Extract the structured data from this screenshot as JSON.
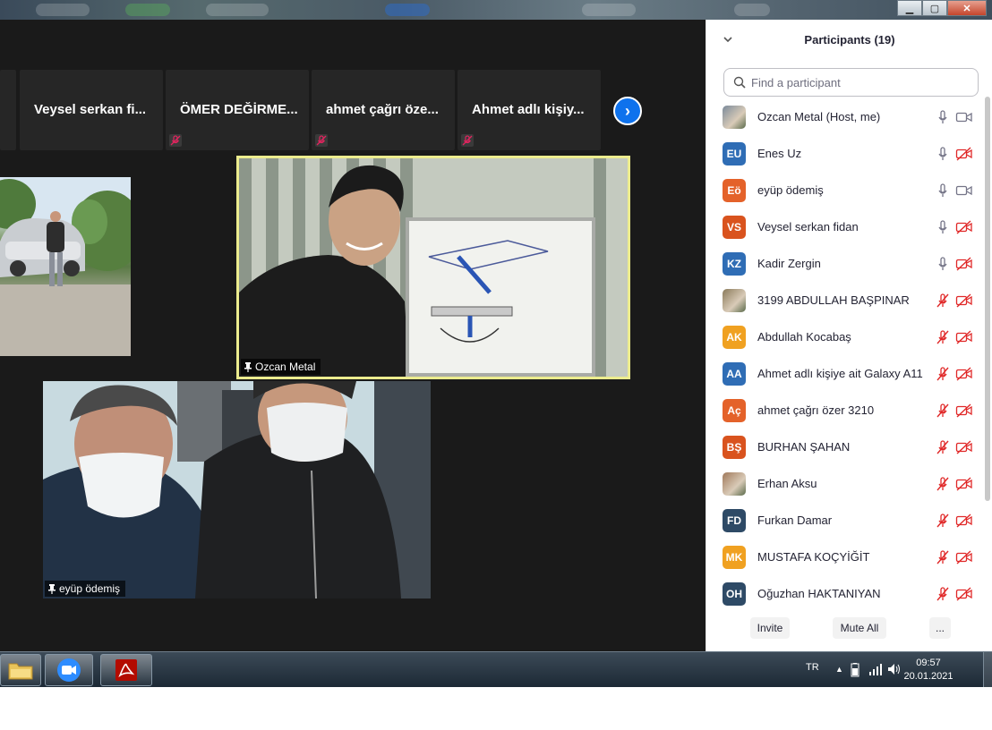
{
  "window": {
    "minimize_icon": "minimize-icon",
    "maximize_icon": "restore-icon",
    "close_icon": "close-icon"
  },
  "video_strip": {
    "tiles": [
      {
        "name": "Veysel serkan fi...",
        "muted": false
      },
      {
        "name": "ÖMER DEĞİRME...",
        "muted": true
      },
      {
        "name": "ahmet çağrı öze...",
        "muted": true
      },
      {
        "name": "Ahmet adlı kişiy...",
        "muted": true
      }
    ],
    "next_icon": "chevron-right-icon"
  },
  "videos": {
    "main_label": "Ozcan Metal",
    "masks_label": "eyüp ödemiş"
  },
  "participants": {
    "title": "Participants (19)",
    "search_placeholder": "Find a participant",
    "list": [
      {
        "name": "Ozcan Metal (Host, me)",
        "initials": "",
        "photo": true,
        "color": "#7a8a9a",
        "mic": "on",
        "cam": "on"
      },
      {
        "name": "Enes Uz",
        "initials": "EU",
        "photo": false,
        "color": "#2f6db5",
        "mic": "on",
        "cam": "off"
      },
      {
        "name": "eyüp ödemiş",
        "initials": "Eö",
        "photo": false,
        "color": "#e4622a",
        "mic": "on",
        "cam": "on"
      },
      {
        "name": "Veysel serkan fidan",
        "initials": "VS",
        "photo": false,
        "color": "#d9531e",
        "mic": "on",
        "cam": "off"
      },
      {
        "name": "Kadir Zergin",
        "initials": "KZ",
        "photo": false,
        "color": "#2f6db5",
        "mic": "on",
        "cam": "off"
      },
      {
        "name": "3199 ABDULLAH BAŞPINAR",
        "initials": "",
        "photo": true,
        "color": "#8a7a5a",
        "mic": "off",
        "cam": "off"
      },
      {
        "name": "Abdullah Kocabaş",
        "initials": "AK",
        "photo": false,
        "color": "#f0a121",
        "mic": "off",
        "cam": "off"
      },
      {
        "name": "Ahmet adlı kişiye ait Galaxy A11",
        "initials": "AA",
        "photo": false,
        "color": "#2f6db5",
        "mic": "off",
        "cam": "off"
      },
      {
        "name": "ahmet çağrı özer 3210",
        "initials": "Aç",
        "photo": false,
        "color": "#e4622a",
        "mic": "off",
        "cam": "off"
      },
      {
        "name": "BURHAN ŞAHAN",
        "initials": "BŞ",
        "photo": false,
        "color": "#d9531e",
        "mic": "off",
        "cam": "off"
      },
      {
        "name": "Erhan Aksu",
        "initials": "",
        "photo": true,
        "color": "#a0785a",
        "mic": "off",
        "cam": "off"
      },
      {
        "name": "Furkan Damar",
        "initials": "FD",
        "photo": false,
        "color": "#2e4a66",
        "mic": "off",
        "cam": "off"
      },
      {
        "name": "MUSTAFA KOÇYİĞİT",
        "initials": "MK",
        "photo": false,
        "color": "#f0a121",
        "mic": "off",
        "cam": "off"
      },
      {
        "name": "Oğuzhan HAKTANIYAN",
        "initials": "OH",
        "photo": false,
        "color": "#2e4a66",
        "mic": "off",
        "cam": "off"
      }
    ],
    "footer": {
      "invite": "Invite",
      "mute_all": "Mute All",
      "more": "..."
    }
  },
  "taskbar": {
    "apps": [
      "file-explorer-icon",
      "zoom-icon",
      "acrobat-reader-icon"
    ],
    "language": "TR",
    "time": "09:57",
    "date": "20.01.2021"
  }
}
